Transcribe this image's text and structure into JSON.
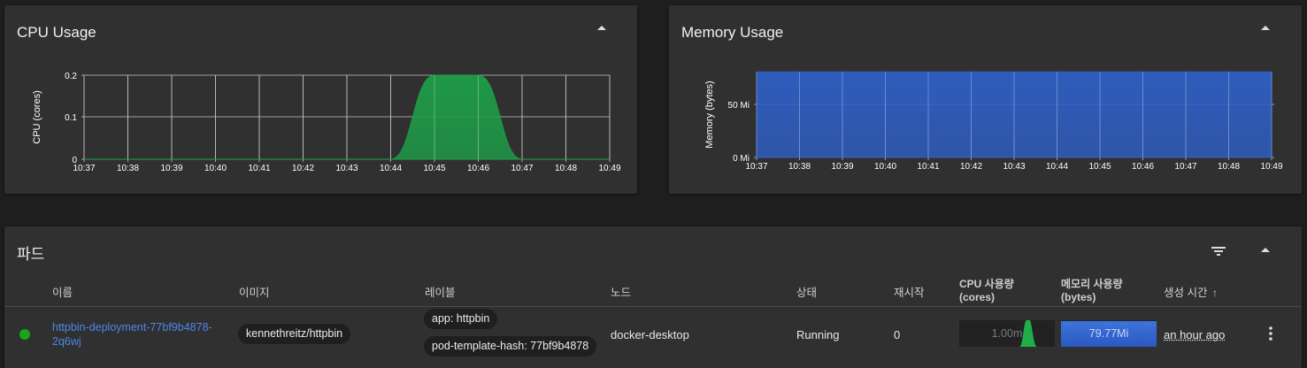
{
  "cpu_panel": {
    "title": "CPU Usage"
  },
  "memory_panel": {
    "title": "Memory Usage"
  },
  "chart_data": [
    {
      "type": "area",
      "ylabel": "CPU (cores)",
      "x": [
        "10:37",
        "10:38",
        "10:39",
        "10:40",
        "10:41",
        "10:42",
        "10:43",
        "10:44",
        "10:45",
        "10:46",
        "10:47",
        "10:48",
        "10:49"
      ],
      "y_ticks": [
        "0.2",
        "0.1",
        "0"
      ],
      "ylim": [
        0,
        0.2
      ],
      "series": [
        {
          "values": [
            0,
            0,
            0,
            0,
            0,
            0,
            0,
            0,
            0.2,
            0.2,
            0,
            0,
            0
          ]
        }
      ],
      "color": "#1e9e48",
      "grid": true
    },
    {
      "type": "area",
      "ylabel": "Memory (bytes)",
      "x": [
        "10:37",
        "10:38",
        "10:39",
        "10:40",
        "10:41",
        "10:42",
        "10:43",
        "10:44",
        "10:45",
        "10:46",
        "10:47",
        "10:48",
        "10:49"
      ],
      "y_ticks": [
        "50 Mi",
        "0 Mi"
      ],
      "ylim": [
        0,
        80
      ],
      "series": [
        {
          "values": [
            79.8,
            79.8,
            79.8,
            79.8,
            79.8,
            79.8,
            79.8,
            79.8,
            79.8,
            79.8,
            79.8,
            79.8,
            79.8
          ]
        }
      ],
      "color": "#2f5fc4",
      "grid": true
    }
  ],
  "pods": {
    "title": "파드",
    "columns": {
      "name": "이름",
      "image": "이미지",
      "labels": "레이블",
      "node": "노드",
      "status": "상태",
      "restarts": "재시작",
      "cpu_1": "CPU 사용량",
      "cpu_2": "(cores)",
      "mem_1": "메모리 사용량",
      "mem_2": "(bytes)",
      "created": "생성 시간"
    },
    "row": {
      "status_color": "#1aa51a",
      "name_line1": "httpbin-deployment-77bf9b4878-",
      "name_line2": "2q6wj",
      "image": "kennethreitz/httpbin",
      "label1": "app: httpbin",
      "label2": "pod-template-hash: 77bf9b4878",
      "node": "docker-desktop",
      "status": "Running",
      "restarts": "0",
      "cpu": "1.00m",
      "memory": "79.77Mi",
      "created": "an hour ago"
    }
  }
}
